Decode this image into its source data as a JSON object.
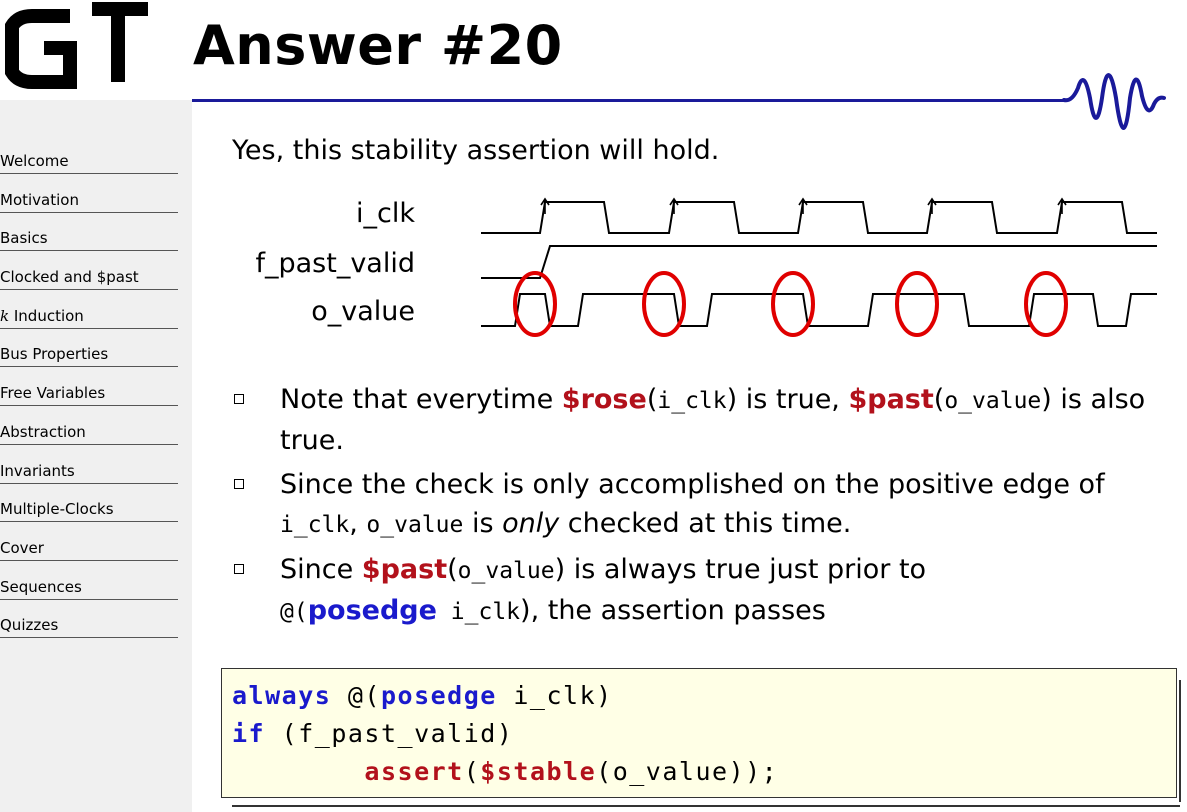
{
  "title": "Answer #20",
  "nav": {
    "items": [
      {
        "label": "Welcome"
      },
      {
        "label": "Motivation"
      },
      {
        "label": "Basics"
      },
      {
        "label": "Clocked and $past"
      },
      {
        "label_var": "k",
        "label_rest": " Induction"
      },
      {
        "label": "Bus Properties"
      },
      {
        "label": "Free Variables"
      },
      {
        "label": "Abstraction"
      },
      {
        "label": "Invariants"
      },
      {
        "label": "Multiple-Clocks"
      },
      {
        "label": "Cover"
      },
      {
        "label": "Sequences"
      },
      {
        "label": "Quizzes"
      }
    ]
  },
  "intro": "Yes, this stability assertion will hold.",
  "timing": {
    "signals": [
      "i_clk",
      "f_past_valid",
      "o_value"
    ],
    "highlight_color": "#e00000"
  },
  "bullets": {
    "b1": {
      "t1": "Note that everytime ",
      "rose": "$rose",
      "t2": "(",
      "c1": "i_clk",
      "t3": ") is true, ",
      "past": "$past",
      "t4": "(",
      "c2": "o_value",
      "t5": ") is also true."
    },
    "b2": {
      "t1": "Since the check is only accomplished on the positive edge of ",
      "c1": "i_clk",
      "t2": ", ",
      "c2": "o_value",
      "t3": " is ",
      "only": "only",
      "t4": " checked at this time."
    },
    "b3": {
      "t1": "Since ",
      "past": "$past",
      "t2": "(",
      "c1": "o_value",
      "t3": ") is always true just prior to ",
      "c2": "@(",
      "posedge": "posedge",
      "c3": " i_clk",
      "t4": "), the assertion passes"
    }
  },
  "code": {
    "l1_kw1": "always",
    "l1_t1": " @(",
    "l1_kw2": "posedge",
    "l1_t2": " i_clk)",
    "l2_kw": "if",
    "l2_t": " (f_past_valid)",
    "l3_indent": "        ",
    "l3_kw": "assert",
    "l3_t1": "(",
    "l3_sf": "$stable",
    "l3_t2": "(o_value));"
  },
  "colors": {
    "accent_blue": "#1a1a9a",
    "keyword_blue": "#1a1acc",
    "system_red": "#b2111b",
    "code_bg": "#ffffe6",
    "sidebar_bg": "#f0f0f0"
  }
}
